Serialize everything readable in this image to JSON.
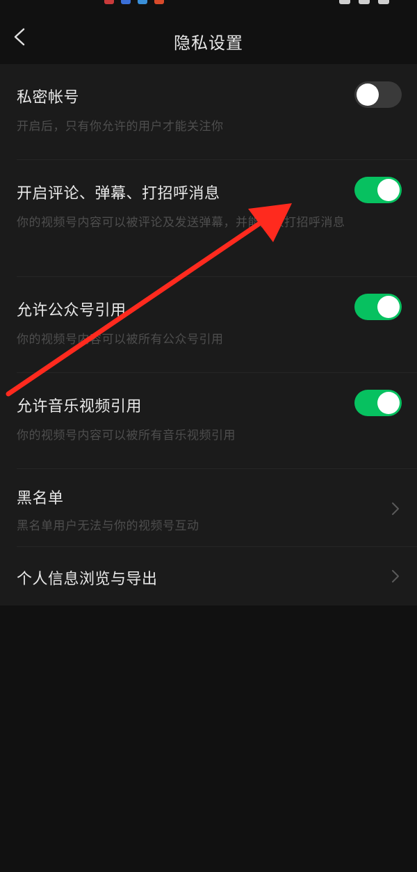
{
  "nav": {
    "title": "隐私设置",
    "back_icon": "chevron-left-icon"
  },
  "settings": [
    {
      "title": "私密帐号",
      "description": "开启后，只有你允许的用户才能关注你",
      "control": "toggle",
      "enabled": false
    },
    {
      "title": "开启评论、弹幕、打招呼消息",
      "description": "你的视频号内容可以被评论及发送弹幕，并能接收打招呼消息",
      "control": "toggle",
      "enabled": true
    },
    {
      "title": "允许公众号引用",
      "description": "你的视频号内容可以被所有公众号引用",
      "control": "toggle",
      "enabled": true
    },
    {
      "title": "允许音乐视频引用",
      "description": "你的视频号内容可以被所有音乐视频引用",
      "control": "toggle",
      "enabled": true
    },
    {
      "title": "黑名单",
      "description": "黑名单用户无法与你的视频号互动",
      "control": "chevron"
    },
    {
      "title": "个人信息浏览与导出",
      "control": "chevron"
    }
  ],
  "colors": {
    "toggle_on": "#07c160",
    "toggle_off": "#3a3a3a",
    "annotation_arrow": "#ff2a1e"
  }
}
